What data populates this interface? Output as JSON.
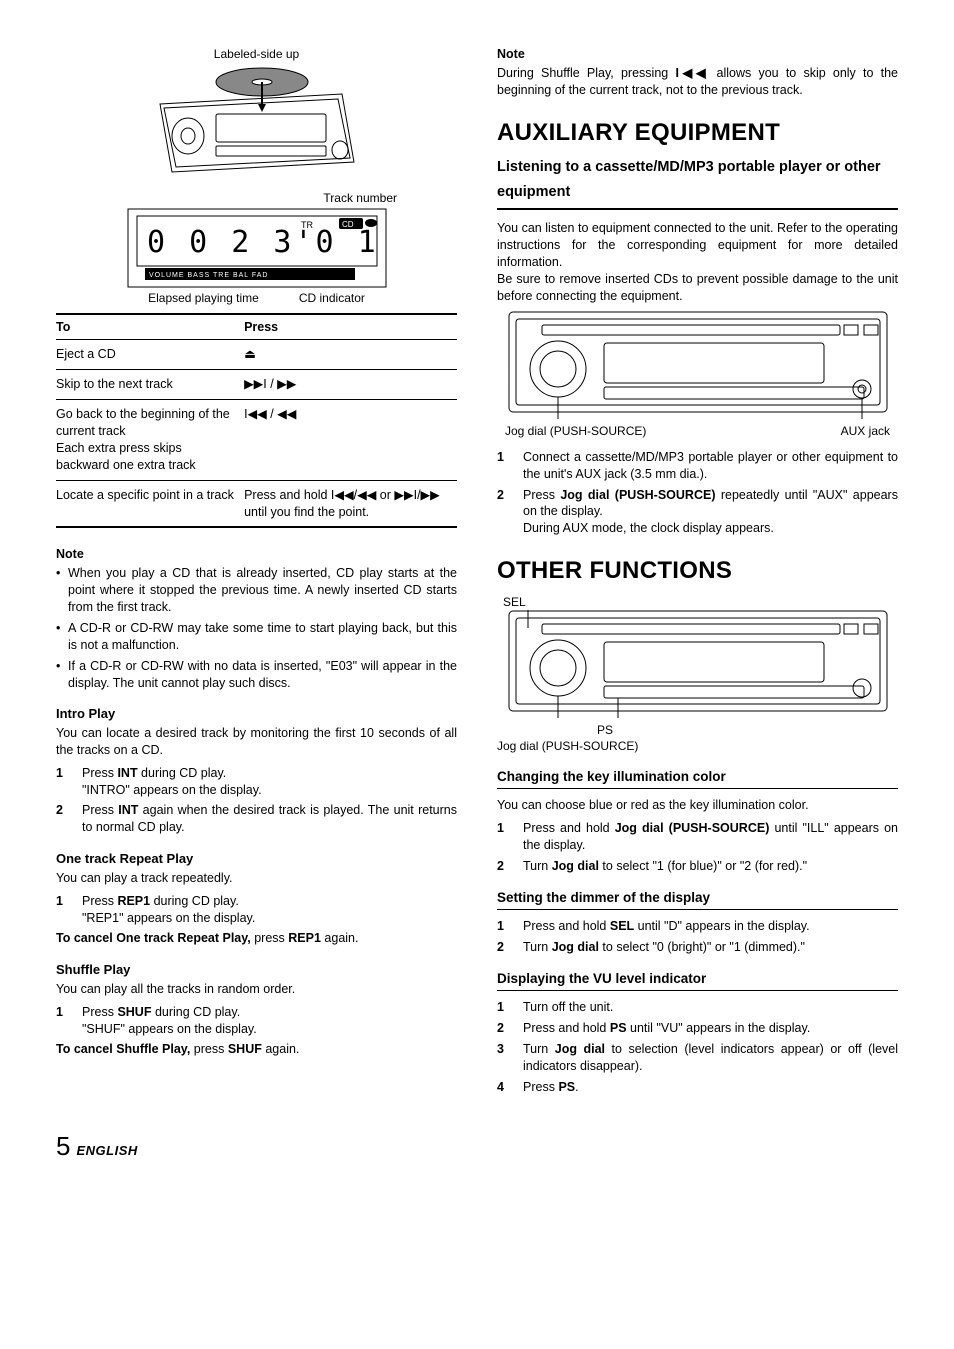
{
  "left": {
    "fig_top_label": "Labeled-side up",
    "fig_track_label": "Track number",
    "lcd_text": "002 3'0 1",
    "lcd_strip": "VOLUME | BASS | TRE | BAL | FAD",
    "elapsed_label": "Elapsed playing time",
    "cd_ind_label": "CD indicator",
    "table": {
      "headers": [
        "To",
        "Press"
      ],
      "rows": [
        {
          "to": "Eject a CD",
          "press": "⏏"
        },
        {
          "to": "Skip to the next track",
          "press": "▶▶I / ▶▶"
        },
        {
          "to": "Go back to the beginning of the current track\nEach extra press skips backward one extra track",
          "press": "I◀◀ / ◀◀"
        },
        {
          "to": "Locate a specific point in a track",
          "press": "Press and hold I◀◀/◀◀ or ▶▶I/▶▶ until you find the point."
        }
      ]
    },
    "note_heading": "Note",
    "notes": [
      "When you play a CD that is already inserted, CD play starts at the point where it stopped the previous time. A newly inserted CD starts from the first track.",
      "A CD-R or CD-RW may take some time to start playing back, but this is not a malfunction.",
      "If a CD-R or CD-RW with no data is inserted, \"E03\" will appear in the display. The unit cannot play such discs."
    ],
    "intro": {
      "heading": "Intro Play",
      "lead": "You can locate a desired track by monitoring the first 10 seconds of all the tracks on a CD.",
      "steps": [
        {
          "num": "1",
          "txt_pre": "Press ",
          "bold": "INT",
          "txt_post": " during CD play.",
          "sub": "\"INTRO\" appears on the display."
        },
        {
          "num": "2",
          "txt_pre": "Press ",
          "bold": "INT",
          "txt_post": " again when the desired track is played. The unit returns to normal CD play."
        }
      ]
    },
    "repeat": {
      "heading": "One track Repeat Play",
      "lead": "You can play a track repeatedly.",
      "steps": [
        {
          "num": "1",
          "txt_pre": "Press ",
          "bold": "REP1",
          "txt_post": " during CD play.",
          "sub": "\"REP1\" appears on the display."
        }
      ],
      "cancel_pre": "To cancel One track Repeat Play, ",
      "cancel_mid": "press ",
      "cancel_bold": "REP1",
      "cancel_post": " again."
    },
    "shuffle": {
      "heading": "Shuffle Play",
      "lead": "You can play all the tracks in random order.",
      "steps": [
        {
          "num": "1",
          "txt_pre": "Press ",
          "bold": "SHUF",
          "txt_post": " during CD play.",
          "sub": "\"SHUF\" appears on the display."
        }
      ],
      "cancel_pre": "To cancel Shuffle Play, ",
      "cancel_mid": "press ",
      "cancel_bold": "SHUF",
      "cancel_post": " again."
    }
  },
  "right": {
    "note_heading": "Note",
    "note_body_pre": "During Shuffle Play, pressing ",
    "note_body_icon": "I◀◀",
    "note_body_post": " allows you to skip only to the beginning of the current track, not to the previous track.",
    "aux_title": "AUXILIARY EQUIPMENT",
    "aux_sub": "Listening to a cassette/MD/MP3 portable player or other equipment",
    "aux_body": "You can listen to equipment connected to the unit. Refer to the operating instructions for the corresponding equipment for more detailed information.\nBe sure to remove inserted CDs to prevent possible damage to the unit before connecting the equipment.",
    "aux_labels": {
      "left": "Jog dial (PUSH-SOURCE)",
      "right": "AUX jack"
    },
    "aux_steps": [
      {
        "num": "1",
        "html": "Connect a cassette/MD/MP3 portable player or other equipment to the unit's AUX jack (3.5 mm dia.)."
      },
      {
        "num": "2",
        "pre": "Press ",
        "bold": "Jog dial (PUSH-SOURCE)",
        "post": " repeatedly until \"AUX\" appears on the display.",
        "sub": "During AUX mode, the clock display appears."
      }
    ],
    "other_title": "OTHER FUNCTIONS",
    "sel_label": "SEL",
    "ps_label": "PS",
    "jog_label": "Jog dial (PUSH-SOURCE)",
    "illum": {
      "heading": "Changing the key illumination color",
      "lead": "You can choose blue or red as the key illumination color.",
      "steps": [
        {
          "num": "1",
          "pre": "Press and hold ",
          "bold": "Jog dial (PUSH-SOURCE)",
          "post": " until \"ILL\" appears on the display."
        },
        {
          "num": "2",
          "pre": "Turn ",
          "bold": "Jog dial",
          "post": " to select \"1 (for blue)\" or \"2 (for red).\""
        }
      ]
    },
    "dimmer": {
      "heading": "Setting the dimmer of the display",
      "steps": [
        {
          "num": "1",
          "pre": "Press and hold ",
          "bold": "SEL",
          "post": " until \"D\" appears in the display."
        },
        {
          "num": "2",
          "pre": "Turn ",
          "bold": "Jog dial",
          "post": " to select \"0 (bright)\" or \"1 (dimmed).\""
        }
      ]
    },
    "vu": {
      "heading": "Displaying the VU level indicator",
      "steps": [
        {
          "num": "1",
          "pre": "Turn off the unit."
        },
        {
          "num": "2",
          "pre": "Press and hold ",
          "bold": "PS",
          "post": " until \"VU\" appears in the display."
        },
        {
          "num": "3",
          "pre": "Turn ",
          "bold": "Jog dial",
          "post": " to selection (level indicators appear) or off (level indicators disappear)."
        },
        {
          "num": "4",
          "pre": "Press ",
          "bold": "PS",
          "post": "."
        }
      ]
    }
  },
  "footer": {
    "page": "5",
    "lang": "ENGLISH"
  }
}
